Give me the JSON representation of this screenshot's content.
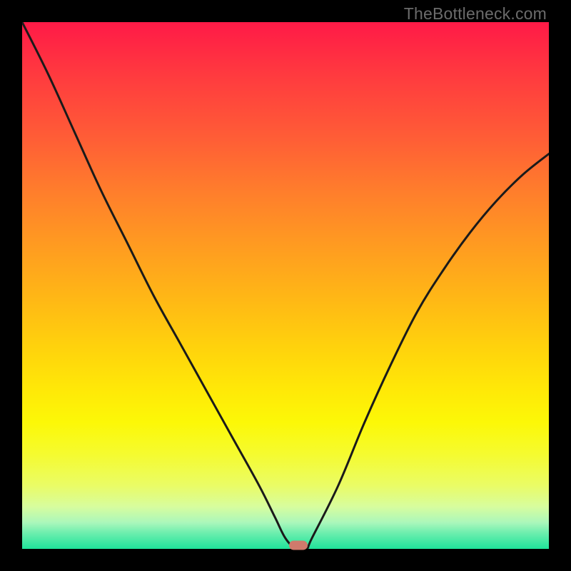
{
  "watermark": "TheBottleneck.com",
  "colors": {
    "frame_bg": "#000000",
    "curve_stroke": "#1a1a1a",
    "marker_fill": "#cf7a6c",
    "gradient_top": "#ff1a47",
    "gradient_bottom": "#1fe39a",
    "watermark_text": "#6b6b6b"
  },
  "chart_data": {
    "type": "line",
    "title": "",
    "xlabel": "",
    "ylabel": "",
    "xlim": [
      0,
      100
    ],
    "ylim": [
      0,
      100
    ],
    "grid": false,
    "legend": false,
    "series": [
      {
        "name": "bottleneck-curve",
        "x": [
          0,
          5,
          10,
          15,
          20,
          25,
          30,
          35,
          40,
          45,
          48,
          50,
          52,
          54,
          55,
          60,
          65,
          70,
          75,
          80,
          85,
          90,
          95,
          100
        ],
        "values": [
          100,
          90,
          79,
          68,
          58,
          48,
          39,
          30,
          21,
          12,
          6,
          2,
          0,
          0,
          2,
          12,
          24,
          35,
          45,
          53,
          60,
          66,
          71,
          75
        ]
      }
    ],
    "annotations": [
      {
        "name": "optimal-marker",
        "x": 52.5,
        "y": 0.7,
        "shape": "rounded-rect"
      }
    ]
  }
}
